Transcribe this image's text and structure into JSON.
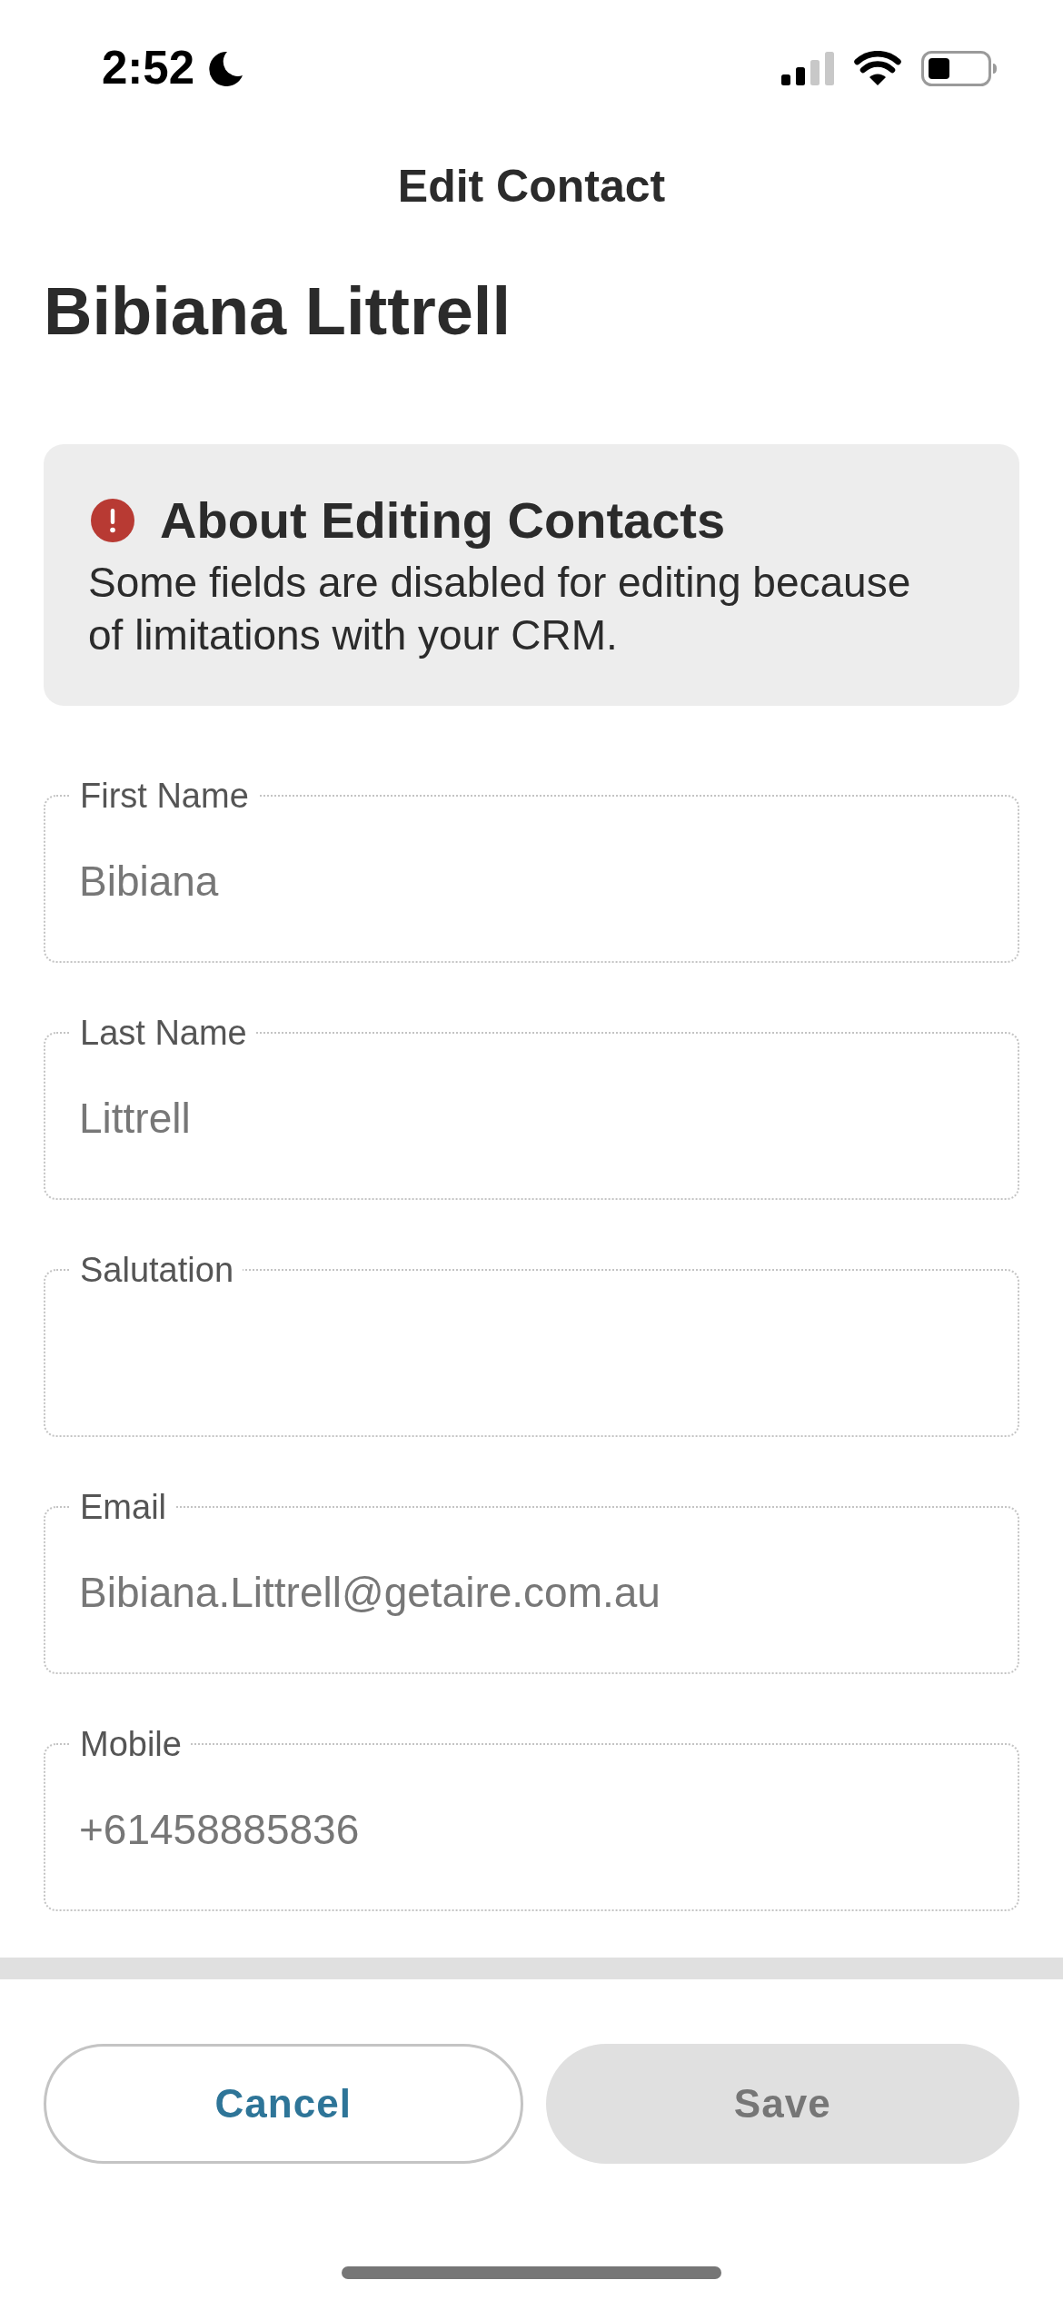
{
  "status_bar": {
    "time": "2:52"
  },
  "header": {
    "title": "Edit Contact"
  },
  "contact_name": "Bibiana Littrell",
  "notice": {
    "title": "About Editing Contacts",
    "body": "Some fields are disabled for editing because of limitations with your CRM."
  },
  "fields": [
    {
      "label": "First Name",
      "value": "Bibiana",
      "disabled": true
    },
    {
      "label": "Last Name",
      "value": "Littrell",
      "disabled": true
    },
    {
      "label": "Salutation",
      "disabled": true
    },
    {
      "label": "Email",
      "value": "Bibiana.Littrell@getaire.com.au",
      "disabled": true
    },
    {
      "label": "Mobile",
      "value": "+61458885836",
      "disabled": true
    }
  ],
  "buttons": [
    {
      "label": "Cancel",
      "disabled": false
    },
    {
      "label": "Save",
      "disabled": true
    }
  ]
}
